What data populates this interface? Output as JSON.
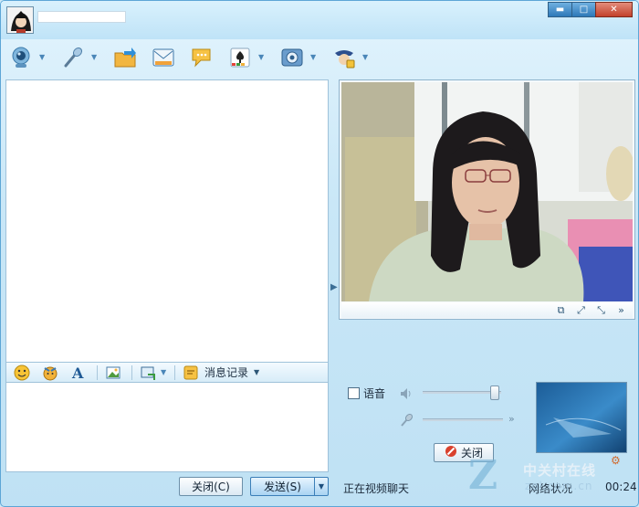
{
  "window": {
    "nickname": "",
    "controls": {
      "minimize": "▬",
      "maximize": "□",
      "close": "✕"
    }
  },
  "toolbar": {
    "items": [
      {
        "icon": "webcam-icon",
        "has_dropdown": true
      },
      {
        "icon": "microphone-icon",
        "has_dropdown": true
      },
      {
        "icon": "send-file-icon",
        "has_dropdown": false
      },
      {
        "icon": "email-icon",
        "has_dropdown": false
      },
      {
        "icon": "chat-bubble-icon",
        "has_dropdown": false
      },
      {
        "icon": "games-icon",
        "has_dropdown": true
      },
      {
        "icon": "app-settings-icon",
        "has_dropdown": true
      },
      {
        "icon": "security-icon",
        "has_dropdown": true
      }
    ]
  },
  "chat_tools": {
    "history_label": "消息记录"
  },
  "chat_buttons": {
    "close_label": "关闭(C)",
    "send_label": "发送(S)",
    "send_dropdown": "▼"
  },
  "video": {
    "caption": "",
    "bar_buttons": [
      "⧉",
      "⤢",
      "⤡",
      "»"
    ],
    "voice_label": "语音",
    "voice_checked": false,
    "speaker_level": 0.95,
    "mic_level": 1.0,
    "more": "»",
    "close_label": "关闭"
  },
  "status": {
    "text": "正在视频聊天",
    "network": "网络状况",
    "timer": "00:24"
  },
  "watermark": {
    "letter": "Z",
    "chinese": "中关村在线",
    "english": "zol.com.cn"
  },
  "colors": {
    "accent": "#2e78b8",
    "close_red": "#c2412b",
    "panel_border": "#9fc2da"
  }
}
